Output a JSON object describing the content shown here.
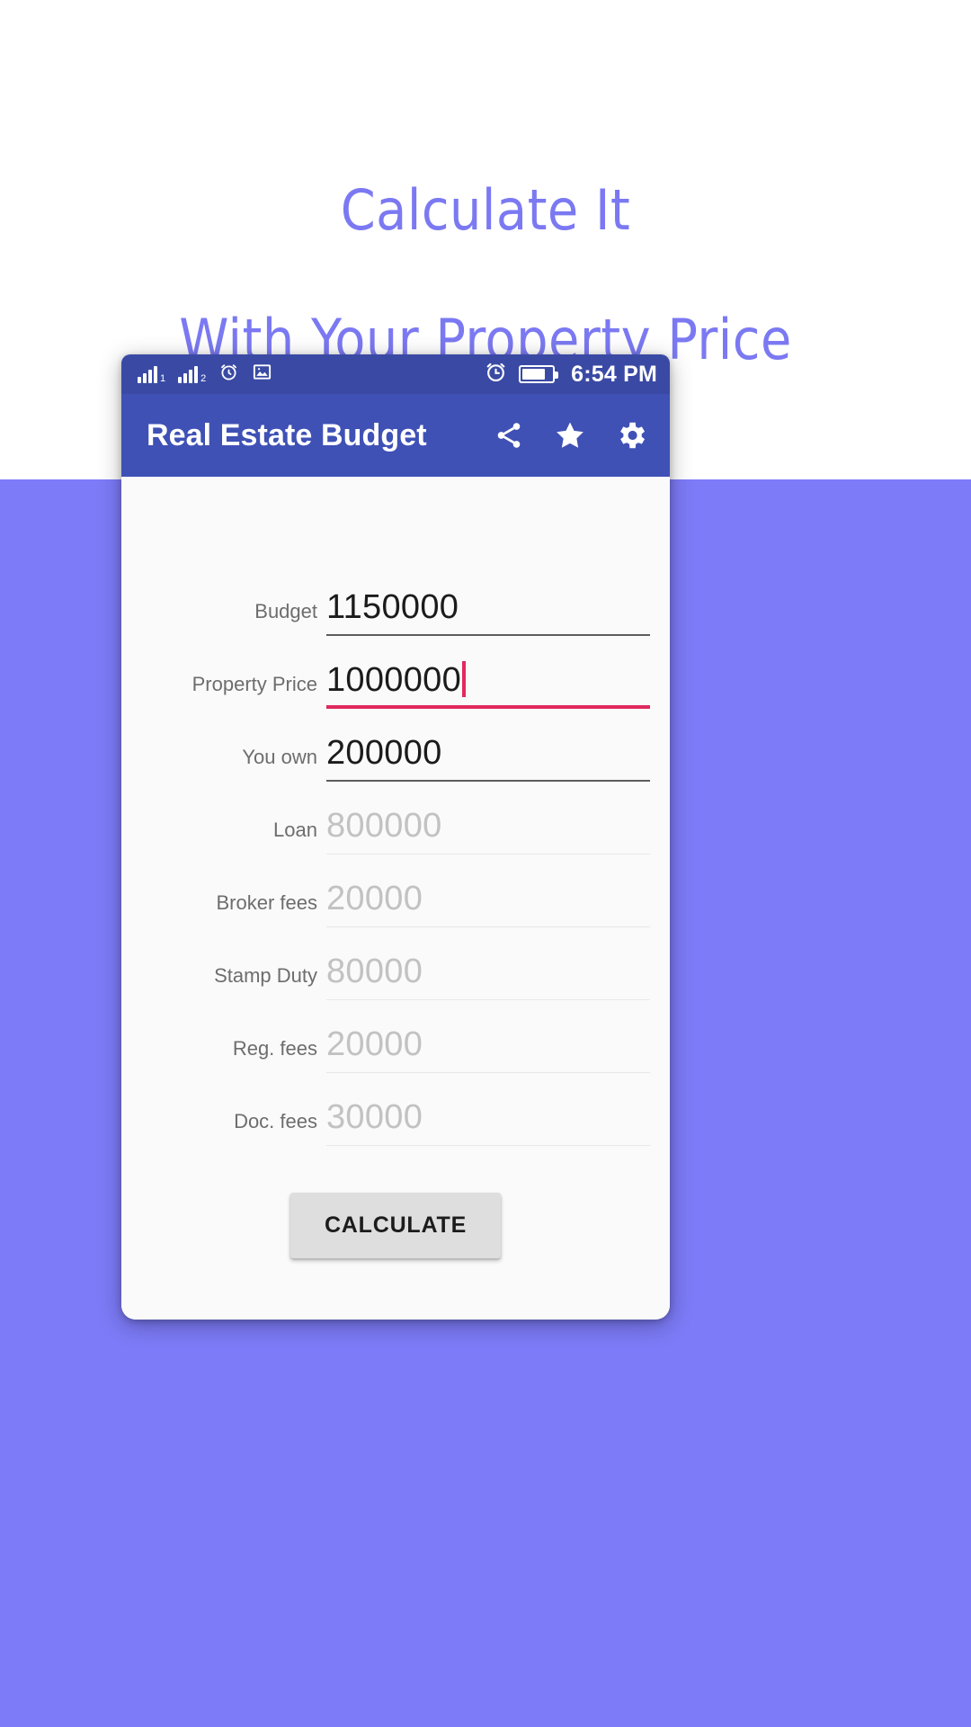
{
  "promo": {
    "headline_line1": "Calculate It",
    "headline_line2": "With Your Property Price",
    "headline_color": "#7b79f2",
    "background_color": "#7d7bf7"
  },
  "status_bar": {
    "sim1_label": "1",
    "sim2_label": "2",
    "time": "6:54 PM",
    "icons": [
      "signal-bars-sim1",
      "signal-bars-sim2",
      "alarm-icon",
      "image-icon",
      "alarm-icon",
      "battery-icon"
    ],
    "background_color": "#3a4aa4"
  },
  "app_bar": {
    "title": "Real Estate Budget",
    "background_color": "#3f51b5",
    "actions": [
      {
        "name": "share",
        "icon": "share-icon"
      },
      {
        "name": "favorite",
        "icon": "star-icon"
      },
      {
        "name": "settings",
        "icon": "gear-icon"
      }
    ]
  },
  "form": {
    "fields": [
      {
        "label": "Budget",
        "value": "1150000",
        "state": "filled"
      },
      {
        "label": "Property Price",
        "value": "1000000",
        "state": "focused"
      },
      {
        "label": "You own",
        "value": "200000",
        "state": "filled"
      },
      {
        "label": "Loan",
        "value": "800000",
        "state": "computed"
      },
      {
        "label": "Broker fees",
        "value": "20000",
        "state": "computed"
      },
      {
        "label": "Stamp Duty",
        "value": "80000",
        "state": "computed"
      },
      {
        "label": "Reg. fees",
        "value": "20000",
        "state": "computed"
      },
      {
        "label": "Doc. fees",
        "value": "30000",
        "state": "computed"
      }
    ],
    "focus_color": "#e0295e",
    "submit_label": "CALCULATE"
  }
}
